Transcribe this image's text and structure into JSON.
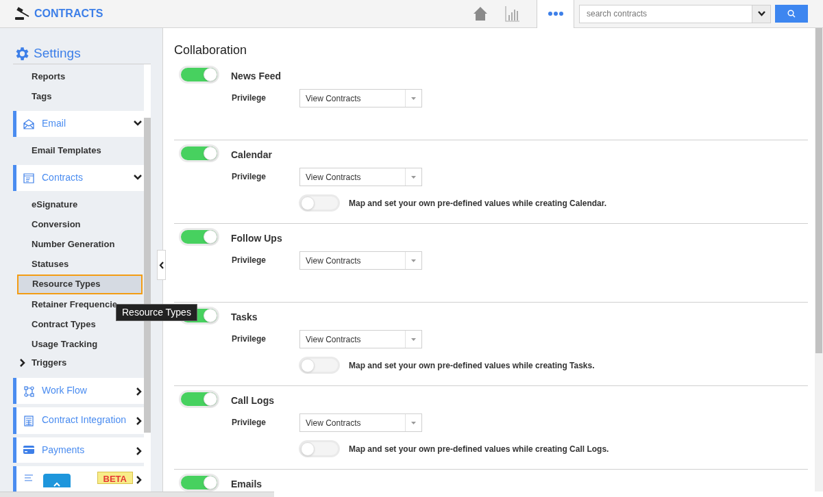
{
  "header": {
    "app_name": "CONTRACTS",
    "search": {
      "placeholder": "search contracts"
    }
  },
  "sidebar": {
    "title": "Settings",
    "items": [
      {
        "kind": "sub",
        "label": "Reports",
        "selected": false
      },
      {
        "kind": "sub",
        "label": "Tags",
        "selected": false
      },
      {
        "kind": "group",
        "label": "Email",
        "expanded": true
      },
      {
        "kind": "sub",
        "label": "Email Templates",
        "selected": false
      },
      {
        "kind": "group",
        "label": "Contracts",
        "expanded": true
      },
      {
        "kind": "sub",
        "label": "eSignature",
        "selected": false
      },
      {
        "kind": "sub",
        "label": "Conversion",
        "selected": false
      },
      {
        "kind": "sub",
        "label": "Number Generation",
        "selected": false
      },
      {
        "kind": "sub",
        "label": "Statuses",
        "selected": false
      },
      {
        "kind": "sub",
        "label": "Resource Types",
        "selected": true
      },
      {
        "kind": "sub",
        "label": "Retainer Frequencie",
        "selected": false
      },
      {
        "kind": "sub",
        "label": "Contract Types",
        "selected": false
      },
      {
        "kind": "sub",
        "label": "Usage Tracking",
        "selected": false
      },
      {
        "kind": "tree",
        "label": "Triggers",
        "expanded": false
      },
      {
        "kind": "group",
        "label": "Work Flow",
        "expanded": false
      },
      {
        "kind": "group",
        "label": "Contract Integration",
        "expanded": false
      },
      {
        "kind": "group",
        "label": "Payments",
        "expanded": false
      },
      {
        "kind": "group",
        "badge": "BETA",
        "expanded": false
      }
    ]
  },
  "tooltip": "Resource Types",
  "content": {
    "title": "Collaboration",
    "sections": [
      {
        "title": "News Feed",
        "on": true,
        "privilege_label": "Privilege",
        "privilege": "View Contracts"
      },
      {
        "title": "Calendar",
        "on": true,
        "privilege_label": "Privilege",
        "privilege": "View Contracts",
        "map": {
          "on": false,
          "text": "Map and set your own pre-defined values while creating Calendar."
        }
      },
      {
        "title": "Follow Ups",
        "on": true,
        "privilege_label": "Privilege",
        "privilege": "View Contracts"
      },
      {
        "title": "Tasks",
        "on": true,
        "privilege_label": "Privilege",
        "privilege": "View Contracts",
        "map": {
          "on": false,
          "text": "Map and set your own pre-defined values while creating Tasks."
        }
      },
      {
        "title": "Call Logs",
        "on": true,
        "privilege_label": "Privilege",
        "privilege": "View Contracts",
        "map": {
          "on": false,
          "text": "Map and set your own pre-defined values while creating Call Logs."
        }
      },
      {
        "title": "Emails",
        "on": true
      }
    ]
  }
}
